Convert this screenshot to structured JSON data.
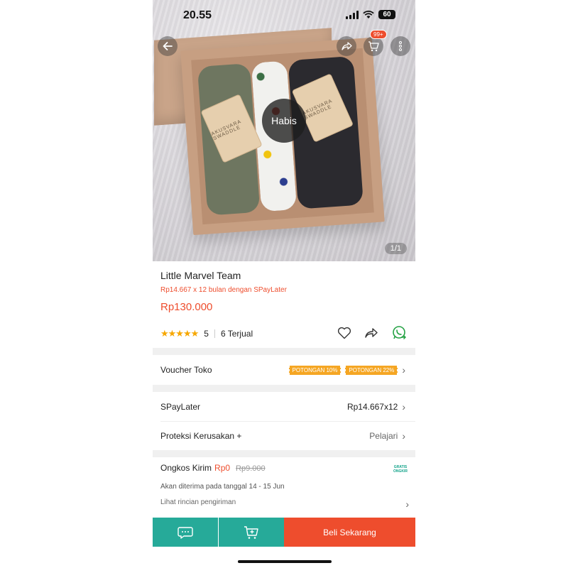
{
  "status_bar": {
    "time": "20.55",
    "battery": "60"
  },
  "header": {
    "cart_badge": "99+"
  },
  "hero": {
    "overlay_label": "Habis",
    "pager": "1/1",
    "tag_text": "AKUSVARA SWADDLE"
  },
  "product": {
    "name": "Little Marvel Team",
    "installment": "Rp14.667 x 12 bulan dengan SPayLater",
    "price": "Rp130.000",
    "rating_stars": "★★★★★",
    "rating_value": "5",
    "sold": "6 Terjual"
  },
  "voucher_row": {
    "label": "Voucher Toko",
    "vouchers": [
      "POTONGAN 10%",
      "POTONGAN 22%"
    ]
  },
  "spaylater_row": {
    "label": "SPayLater",
    "value": "Rp14.667x12"
  },
  "protection_row": {
    "label": "Proteksi Kerusakan +",
    "value": "Pelajari"
  },
  "shipping": {
    "label": "Ongkos Kirim",
    "price": "Rp0",
    "old_price": "Rp9.000",
    "badge_line1": "GRATIS",
    "badge_line2": "ONGKIR",
    "delivery": "Akan diterima pada tanggal 14 - 15 Jun",
    "details_link": "Lihat rincian pengiriman"
  },
  "bottom_bar": {
    "buy_label": "Beli Sekarang"
  },
  "colors": {
    "accent": "#ee4d2d",
    "teal": "#26aa99",
    "star": "#f6a700",
    "voucher": "#f5a623"
  }
}
